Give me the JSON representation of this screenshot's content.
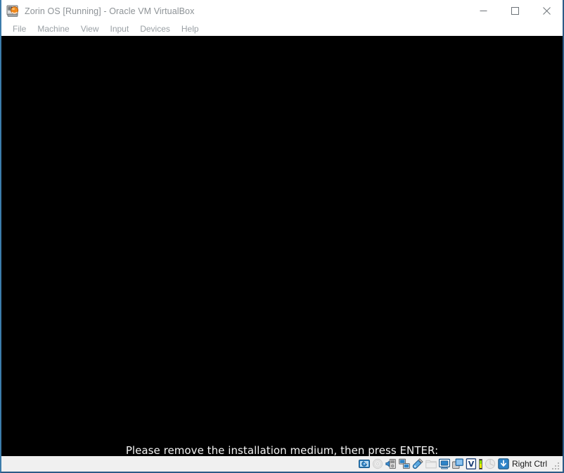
{
  "window": {
    "title": "Zorin OS [Running] - Oracle VM VirtualBox",
    "icon_name": "virtualbox-machine-icon",
    "controls": [
      {
        "name": "minimize-button",
        "label": "Minimize",
        "glyph": "minimize"
      },
      {
        "name": "maximize-button",
        "label": "Maximize",
        "glyph": "maximize"
      },
      {
        "name": "close-button",
        "label": "Close",
        "glyph": "close"
      }
    ],
    "frame_border_color": "#2c5b86",
    "titlebar_background": "#ffffff",
    "title_text_color": "#8d9296"
  },
  "menubar": {
    "items": [
      {
        "label": "File",
        "name": "menu-file"
      },
      {
        "label": "Machine",
        "name": "menu-machine"
      },
      {
        "label": "View",
        "name": "menu-view"
      },
      {
        "label": "Input",
        "name": "menu-input"
      },
      {
        "label": "Devices",
        "name": "menu-devices"
      },
      {
        "label": "Help",
        "name": "menu-help"
      }
    ],
    "text_color": "#9aa0a5"
  },
  "vm_screen": {
    "background": "#000000",
    "console_text": "Please remove the installation medium, then press ENTER:",
    "text_color": "#f2f2f2"
  },
  "statusbar": {
    "background": "#f0f0f0",
    "host_key_label": "Right Ctrl",
    "icons": [
      {
        "name": "hard-disk-icon",
        "tooltip": "Hard Disks",
        "state": "active"
      },
      {
        "name": "optical-drive-icon",
        "tooltip": "Optical Drives",
        "state": "disabled"
      },
      {
        "name": "audio-icon",
        "tooltip": "Audio",
        "state": "active"
      },
      {
        "name": "network-icon",
        "tooltip": "Network",
        "state": "active"
      },
      {
        "name": "usb-icon",
        "tooltip": "USB Devices",
        "state": "active"
      },
      {
        "name": "shared-folders-icon",
        "tooltip": "Shared Folders",
        "state": "disabled"
      },
      {
        "name": "display-icon",
        "tooltip": "Display",
        "state": "active"
      },
      {
        "name": "recording-icon",
        "tooltip": "Recording",
        "state": "active"
      },
      {
        "name": "virtualbox-features-icon",
        "tooltip": "VirtualBox Features",
        "state": "active"
      },
      {
        "name": "cpu-load-indicator",
        "tooltip": "CPU Load",
        "state": "active"
      },
      {
        "name": "mouse-integration-icon",
        "tooltip": "Mouse Integration",
        "state": "disabled"
      },
      {
        "name": "host-key-icon",
        "tooltip": "Host Key Combination",
        "state": "active"
      }
    ],
    "resize_grip_name": "resize-grip"
  }
}
